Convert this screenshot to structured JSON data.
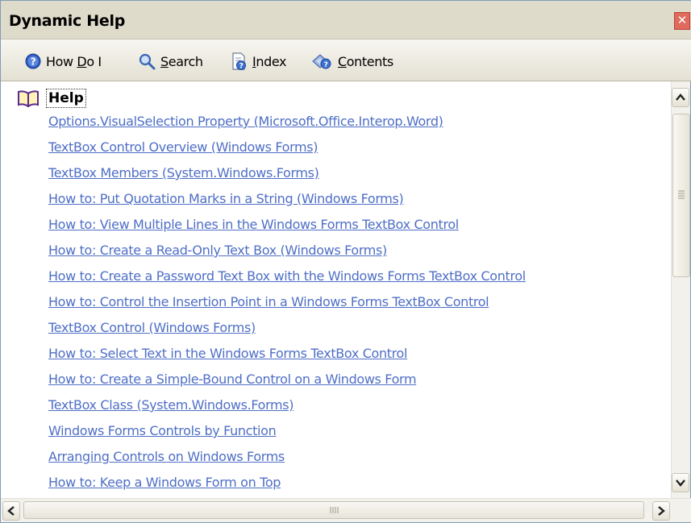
{
  "window": {
    "title": "Dynamic Help",
    "close_glyph": "✕"
  },
  "toolbar": {
    "items": [
      {
        "label_pre": "How ",
        "label_key": "D",
        "label_post": "o I",
        "icon": "help-circle-icon"
      },
      {
        "label_pre": "",
        "label_key": "S",
        "label_post": "earch",
        "icon": "magnifier-icon"
      },
      {
        "label_pre": "",
        "label_key": "I",
        "label_post": "ndex",
        "icon": "index-icon"
      },
      {
        "label_pre": "",
        "label_key": "C",
        "label_post": "ontents",
        "icon": "contents-icon"
      }
    ]
  },
  "help": {
    "heading": "Help",
    "heading_icon": "open-book-icon",
    "links": [
      "Options.VisualSelection Property (Microsoft.Office.Interop.Word)",
      "TextBox Control Overview (Windows Forms)",
      "TextBox Members (System.Windows.Forms)",
      "How to: Put Quotation Marks in a String (Windows Forms)",
      "How to: View Multiple Lines in the Windows Forms TextBox Control",
      "How to: Create a Read-Only Text Box (Windows Forms)",
      "How to: Create a Password Text Box with the Windows Forms TextBox Control",
      "How to: Control the Insertion Point in a Windows Forms TextBox Control",
      "TextBox Control (Windows Forms)",
      "How to: Select Text in the Windows Forms TextBox Control",
      "How to: Create a Simple-Bound Control on a Windows Form",
      "TextBox Class (System.Windows.Forms)",
      "Windows Forms Controls by Function",
      "Arranging Controls on Windows Forms",
      "How to: Keep a Windows Form on Top"
    ]
  },
  "colors": {
    "link": "#4f6fc6",
    "titlebar": "#dedbcb",
    "close": "#e06a5c"
  }
}
